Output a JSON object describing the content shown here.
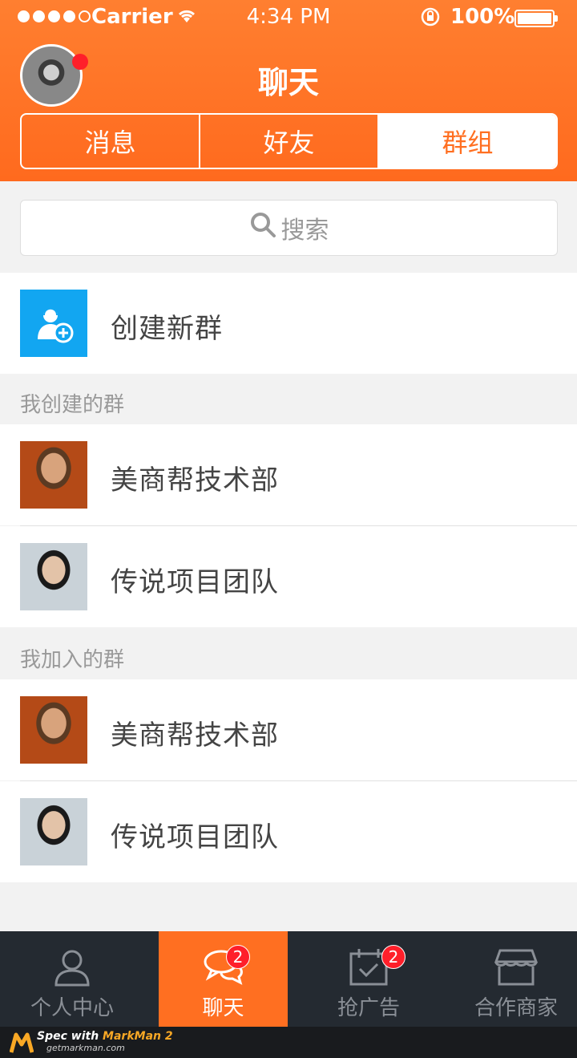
{
  "status_bar": {
    "carrier": "Carrier",
    "time": "4:34 PM",
    "battery": "100%"
  },
  "header": {
    "title": "聊天",
    "segments": [
      "消息",
      "好友",
      "群组"
    ],
    "active_segment": "群组"
  },
  "search": {
    "placeholder": "搜索"
  },
  "create_group": {
    "label": "创建新群"
  },
  "sections": {
    "created": {
      "title": "我创建的群",
      "groups": [
        {
          "name": "美商帮技术部"
        },
        {
          "name": "传说项目团队"
        }
      ]
    },
    "joined": {
      "title": "我加入的群",
      "groups": [
        {
          "name": "美商帮技术部"
        },
        {
          "name": "传说项目团队"
        }
      ]
    }
  },
  "tabbar": {
    "items": [
      {
        "label": "个人中心",
        "icon": "person-icon"
      },
      {
        "label": "聊天",
        "icon": "chat-bubbles-icon",
        "badge": "2",
        "active": true
      },
      {
        "label": "抢广告",
        "icon": "calendar-check-icon",
        "badge": "2"
      },
      {
        "label": "合作商家",
        "icon": "shop-icon"
      }
    ]
  },
  "footer": {
    "brand_prefix": "Spec with ",
    "brand": "MarkMan 2",
    "url": "getmarkman.com"
  },
  "colors": {
    "accent": "#ff6f21",
    "badge": "#ff1f2a",
    "tabbar_bg": "#242a31",
    "text_primary": "#444444",
    "text_secondary": "#999999"
  }
}
